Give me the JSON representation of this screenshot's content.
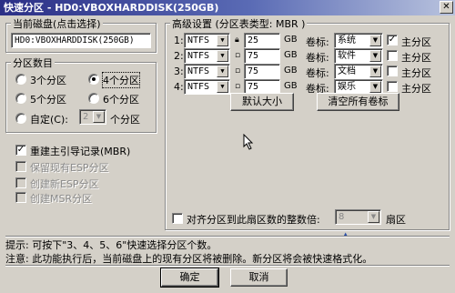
{
  "title": "快速分区 - HD0:VBOXHARDDISK(250GB)",
  "disk_group": {
    "legend": "当前磁盘(点击选择)",
    "value": "HD0:VBOXHARDDISK(250GB)"
  },
  "count_group": {
    "legend": "分区数目",
    "options": [
      "3个分区",
      "4个分区",
      "5个分区",
      "6个分区"
    ],
    "selected": "4个分区",
    "custom_label": "自定(C):",
    "custom_value": "2",
    "custom_suffix": "个分区"
  },
  "options_group": [
    {
      "label": "重建主引导记录(MBR)",
      "checked": true,
      "enabled": true
    },
    {
      "label": "保留现有ESP分区",
      "checked": false,
      "enabled": false
    },
    {
      "label": "创建新ESP分区",
      "checked": false,
      "enabled": false
    },
    {
      "label": "创建MSR分区",
      "checked": false,
      "enabled": false
    }
  ],
  "advanced": {
    "legend": "高级设置  (分区表类型: MBR )",
    "size_unit": "GB",
    "volume_label_caption": "卷标:",
    "primary_label": "主分区",
    "rows": [
      {
        "index": "1:",
        "fs": "NTFS",
        "size": "25",
        "locked": true,
        "label": "系统",
        "primary": true
      },
      {
        "index": "2:",
        "fs": "NTFS",
        "size": "75",
        "locked": false,
        "label": "软件",
        "primary": false
      },
      {
        "index": "3:",
        "fs": "NTFS",
        "size": "75",
        "locked": false,
        "label": "文档",
        "primary": false
      },
      {
        "index": "4:",
        "fs": "NTFS",
        "size": "75",
        "locked": false,
        "label": "娱乐",
        "primary": false
      }
    ],
    "default_size_button": "默认大小",
    "clear_labels_button": "清空所有卷标",
    "align_label": "对齐分区到此扇区数的整数倍:",
    "align_value": "8",
    "align_suffix": "扇区"
  },
  "hint": "提示:  可按下\"3、4、5、6\"快速选择分区个数。",
  "note": "注意:  此功能执行后，当前磁盘上的现有分区将被删除。新分区将会被快速格式化。",
  "ok_button": "确定",
  "cancel_button": "取消",
  "colors": {
    "title_start": "#2b2f86",
    "title_end": "#b9c3de",
    "face": "#d4d0c8"
  }
}
